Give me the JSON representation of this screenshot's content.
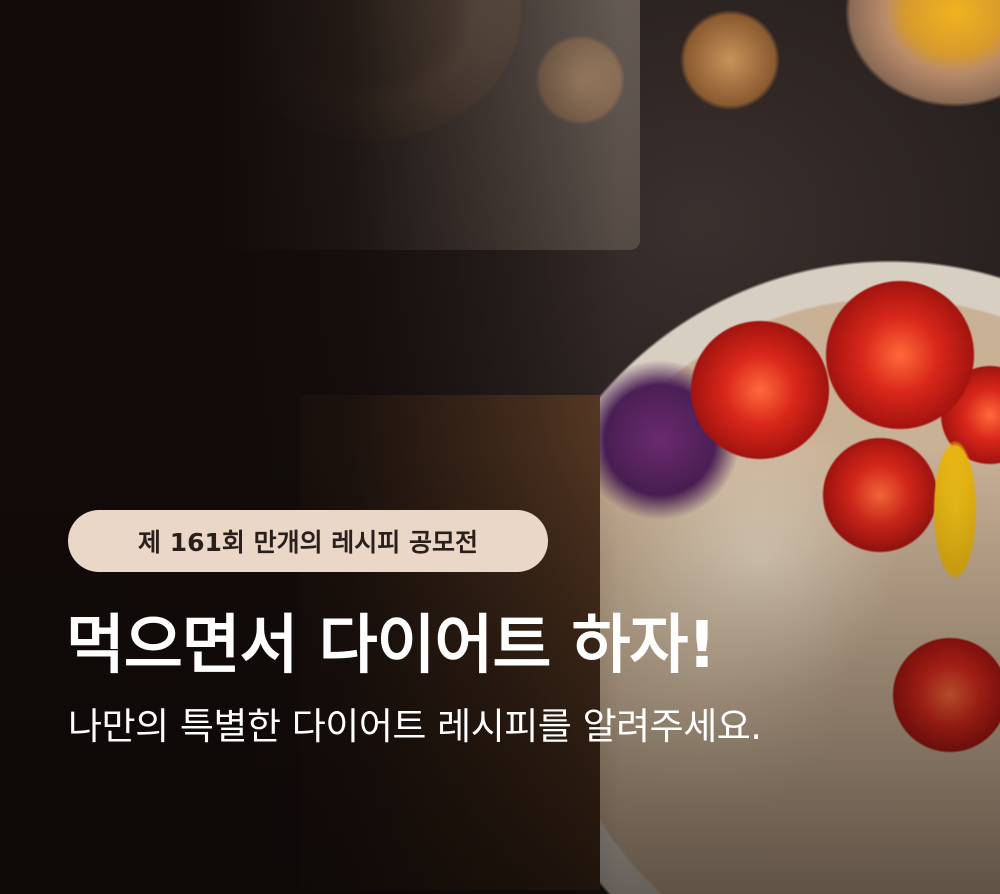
{
  "banner": {
    "badge": "제 161회 만개의 레시피 공모전",
    "title": "먹으면서 다이어트 하자!",
    "subtitle": "나만의 특별한 다이어트 레시피를 알려주세요.",
    "colors": {
      "badge_bg": "#ead7c8",
      "badge_text": "#2a1f1a",
      "background": "#120b09",
      "text": "#ffffff"
    }
  }
}
